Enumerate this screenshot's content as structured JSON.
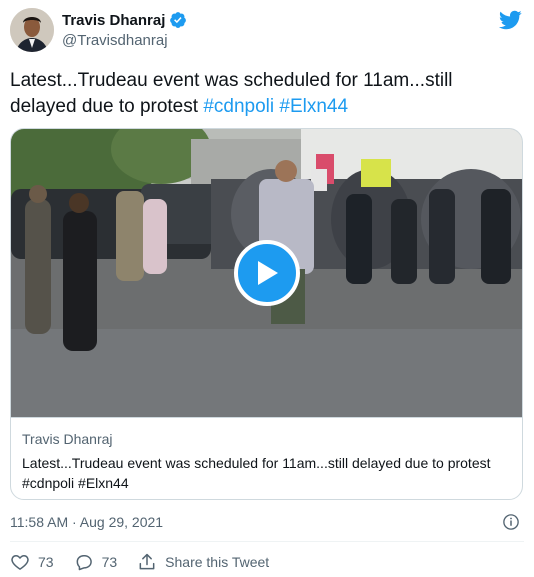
{
  "author": {
    "display_name": "Travis Dhanraj",
    "handle": "@Travisdhanraj"
  },
  "tweet": {
    "text_parts": [
      "Latest...Trudeau event was scheduled for 11am...still delayed due to protest ",
      "#cdnpoli",
      " ",
      "#Elxn44"
    ]
  },
  "card": {
    "title": "Travis Dhanraj",
    "description": "Latest...Trudeau event was scheduled for 11am...still delayed due to protest #cdnpoli #Elxn44"
  },
  "meta": {
    "timestamp": "11:58 AM · Aug 29, 2021"
  },
  "actions": {
    "like_count": "73",
    "reply_count": "73",
    "share_label": "Share this Tweet"
  },
  "colors": {
    "accent": "#1d9bf0",
    "text": "#0f1419",
    "muted": "#536471"
  },
  "icons": [
    "verified-badge-icon",
    "twitter-bird-icon",
    "play-icon",
    "info-icon",
    "heart-icon",
    "reply-icon",
    "share-icon"
  ]
}
